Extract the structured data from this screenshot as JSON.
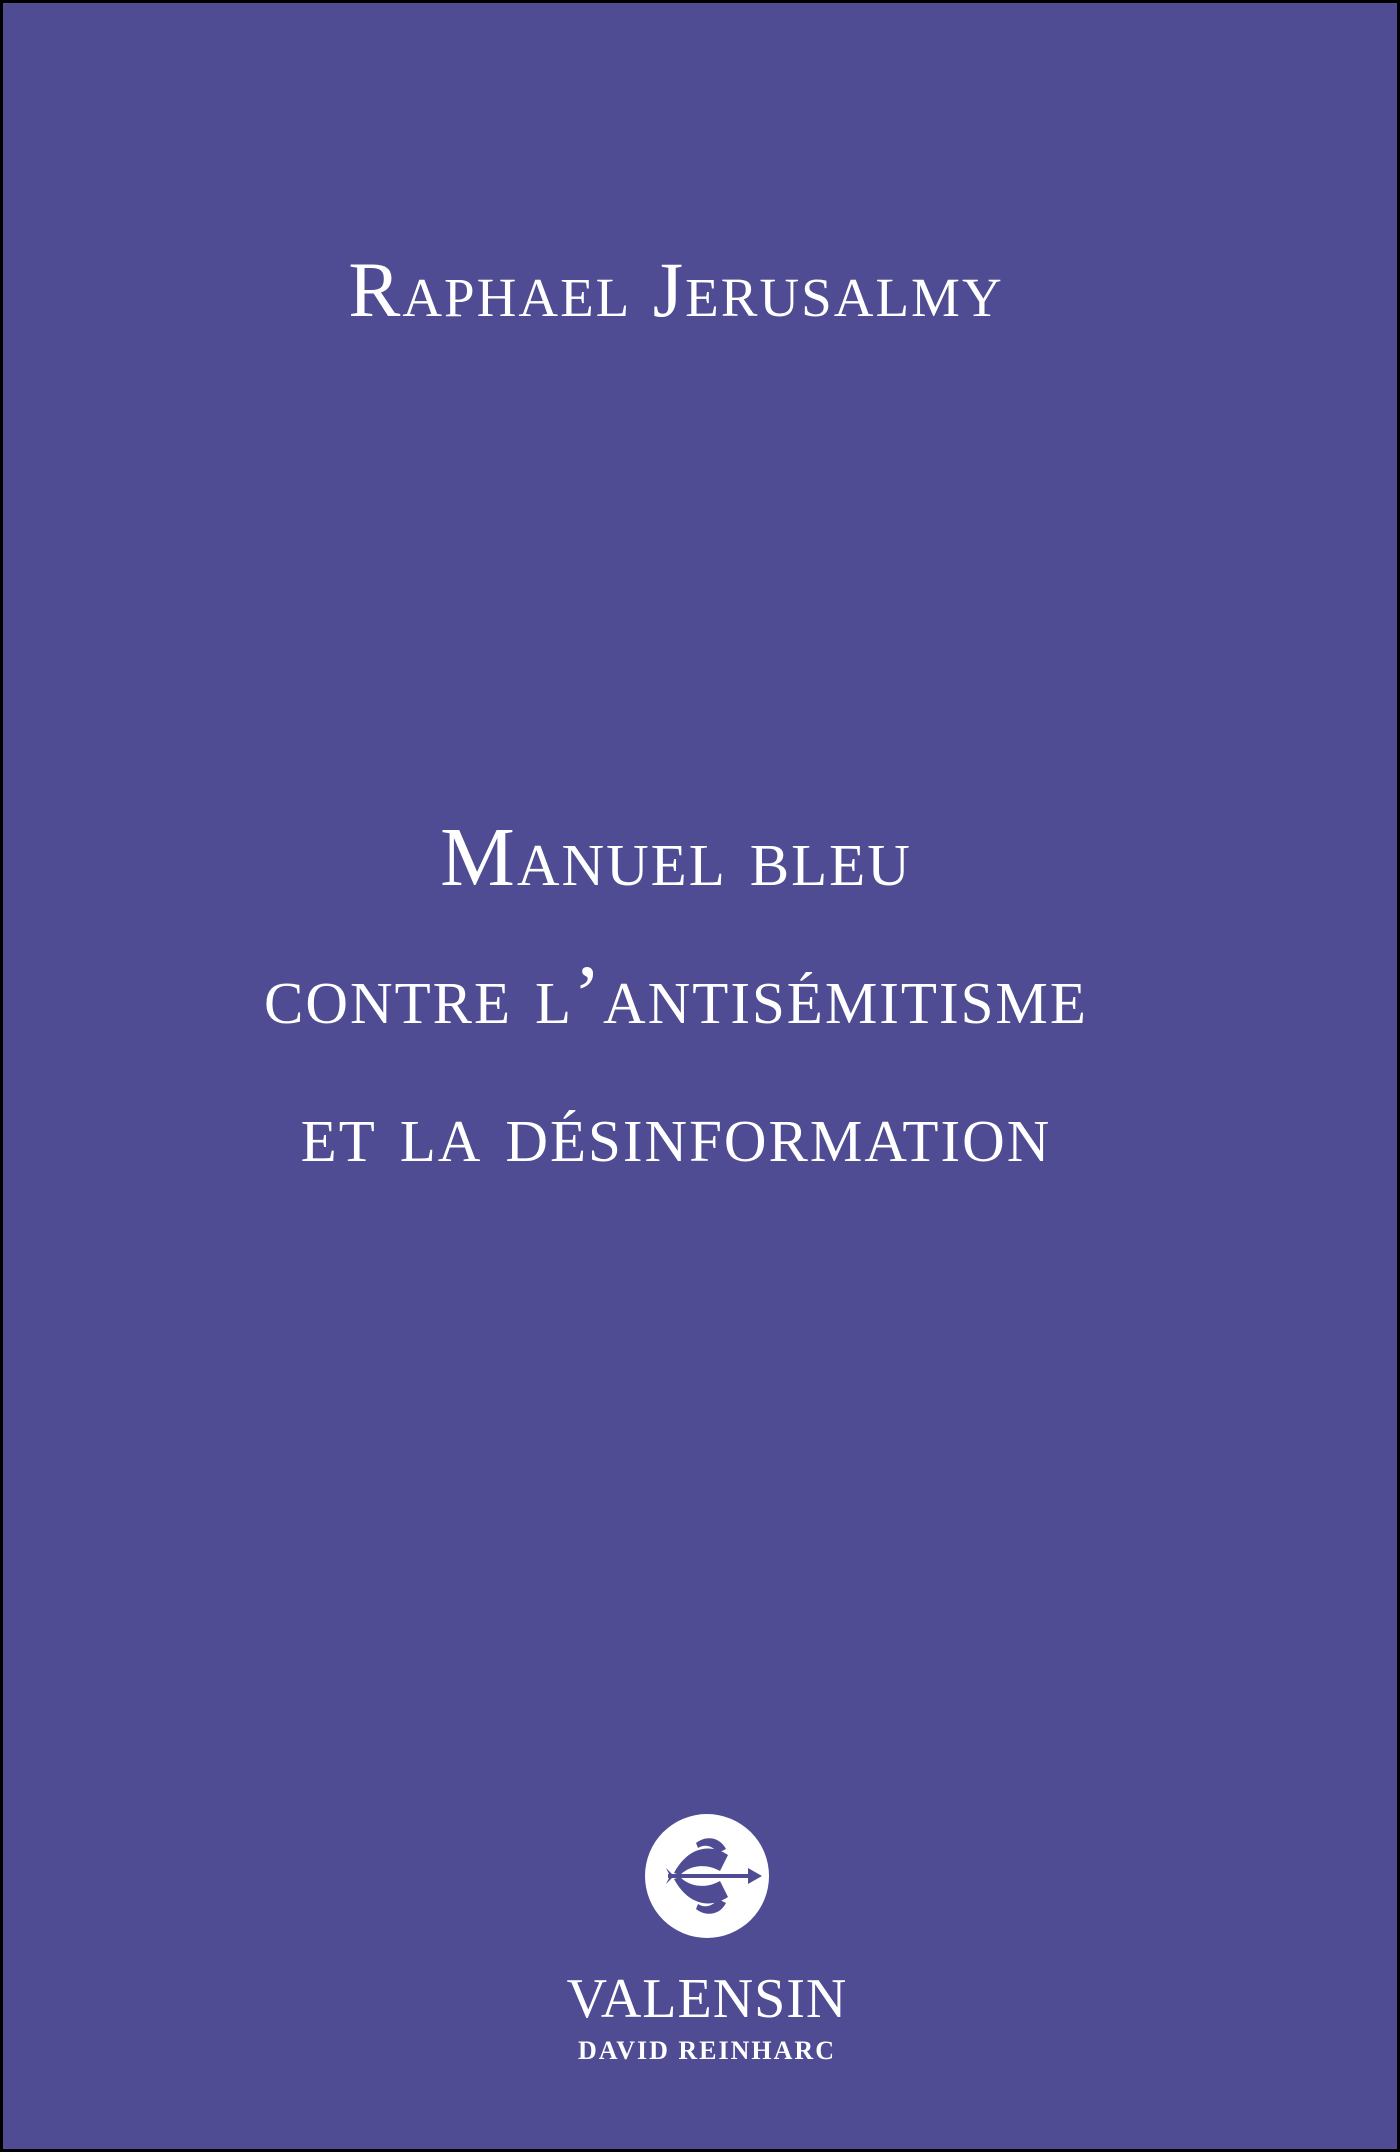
{
  "cover": {
    "background_color": "#4f4c93",
    "text_color": "#ffffff",
    "border_color": "#000000",
    "author": "Raphael Jerusalmy",
    "title_lines": [
      "Manuel bleu",
      "contre l’antisémitisme",
      "et la désinformation"
    ],
    "logo_icon": "book-arrow-emblem-icon",
    "publisher": "VALENSIN",
    "imprint": "DAVID REINHARC"
  }
}
